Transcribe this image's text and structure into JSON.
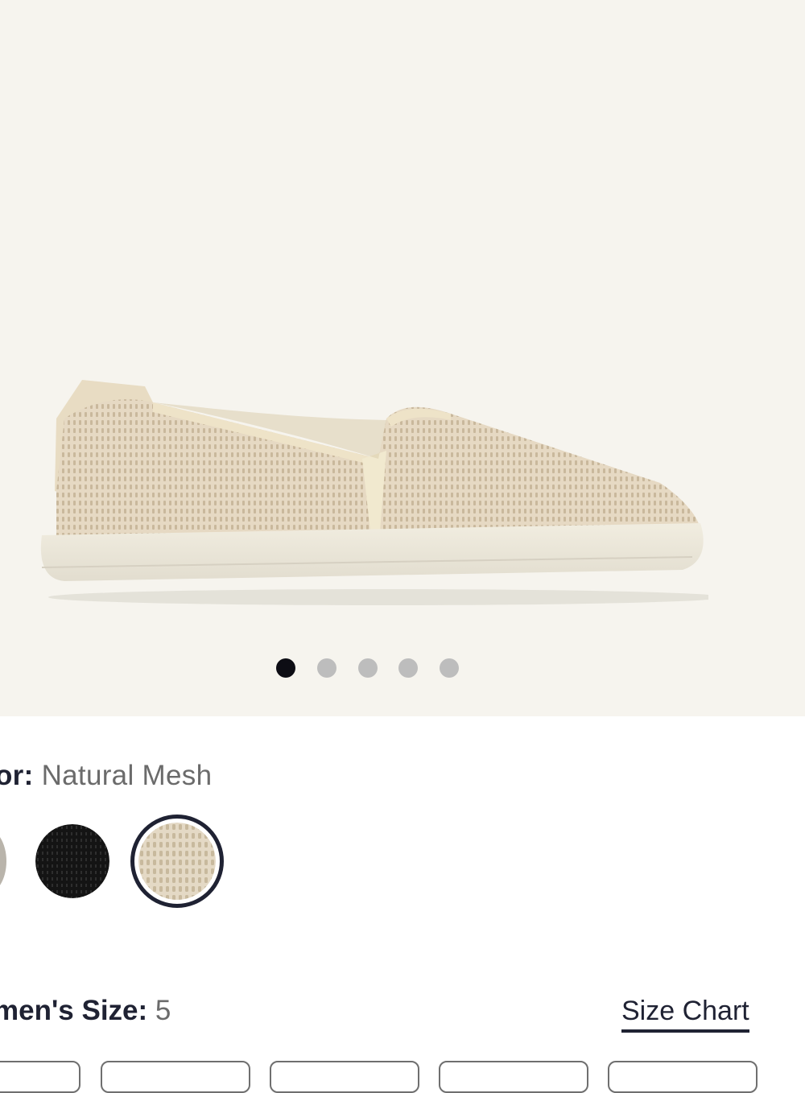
{
  "gallery": {
    "dots_count": 5,
    "active_index": 0,
    "image_alt": "Natural Mesh slip-on sneaker"
  },
  "color": {
    "label": "Color:",
    "label_visible": "or:",
    "value": "Natural Mesh",
    "swatches": [
      {
        "name": "gray",
        "selected": false
      },
      {
        "name": "black",
        "selected": false
      },
      {
        "name": "natural",
        "selected": true
      }
    ]
  },
  "size": {
    "label_visible": "men's Size:",
    "value": "5",
    "size_chart": "Size Chart"
  },
  "colors": {
    "background": "#f6f4ee",
    "dark": "#1f2233",
    "dot_inactive": "#bdbdbd",
    "dot_active": "#0d0d14"
  }
}
